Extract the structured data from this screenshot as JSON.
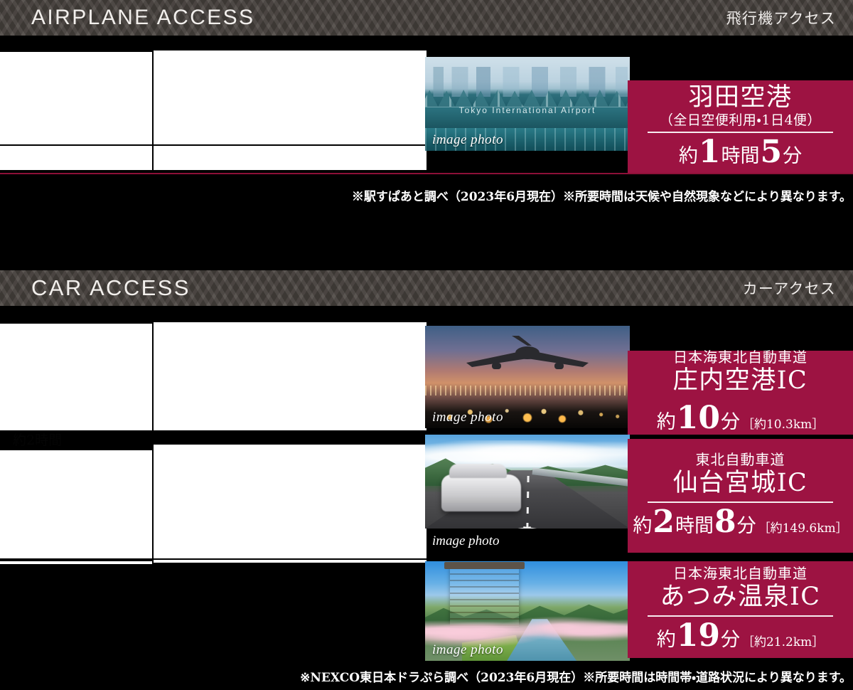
{
  "sections": [
    {
      "id": "airplane",
      "heading_en": "AIRPLANE ACCESS",
      "heading_ja": "飛行機アクセス",
      "note": "※駅すぱあと調べ（2023年6月現在）※所要時間は天候や自然現象などにより異なります。",
      "rows": [
        {
          "photo_caption": "image photo",
          "photo_alt": "羽田空港",
          "photo_sign": "Tokyo International Airport",
          "label_small": "",
          "label_main": "羽田空港",
          "label_sub": "（全日空便利用・1日4便）",
          "time_prefix": "約",
          "time_num1": "1",
          "time_mid": "時間",
          "time_num2": "5",
          "time_suffix": "分",
          "distance": ""
        }
      ]
    },
    {
      "id": "car",
      "heading_en": "CAR ACCESS",
      "heading_ja": "カーアクセス",
      "note": "※NEXCO東日本ドラぷら調べ（2023年6月現在）※所要時間は時間帯・道路状況により異なります。",
      "rows": [
        {
          "photo_caption": "image photo",
          "photo_alt": "庄内空港",
          "label_small": "日本海東北自動車道",
          "label_main": "庄内空港IC",
          "label_sub": "",
          "time_prefix": "約",
          "time_num1": "10",
          "time_mid": "",
          "time_num2": "",
          "time_suffix": "分",
          "distance": "［約10.3km］"
        },
        {
          "photo_caption": "image photo",
          "photo_alt": "高速道路",
          "label_small": "東北自動車道",
          "label_main": "仙台宮城IC",
          "label_sub": "",
          "time_prefix": "約",
          "time_num1": "2",
          "time_mid": "時間",
          "time_num2": "8",
          "time_suffix": "分",
          "distance": "［約149.6km］"
        },
        {
          "photo_caption": "image photo",
          "photo_alt": "あつみ温泉",
          "label_small": "日本海東北自動車道",
          "label_main": "あつみ温泉IC",
          "label_sub": "",
          "time_prefix": "約",
          "time_num1": "19",
          "time_mid": "",
          "time_num2": "",
          "time_suffix": "分",
          "distance": "［約21.2km］"
        }
      ]
    }
  ],
  "ghost_text": "約2時間",
  "colors": {
    "crimson": "#9d1342",
    "header_bar": "#4a4440",
    "background": "#000000",
    "panel": "#ffffff"
  }
}
